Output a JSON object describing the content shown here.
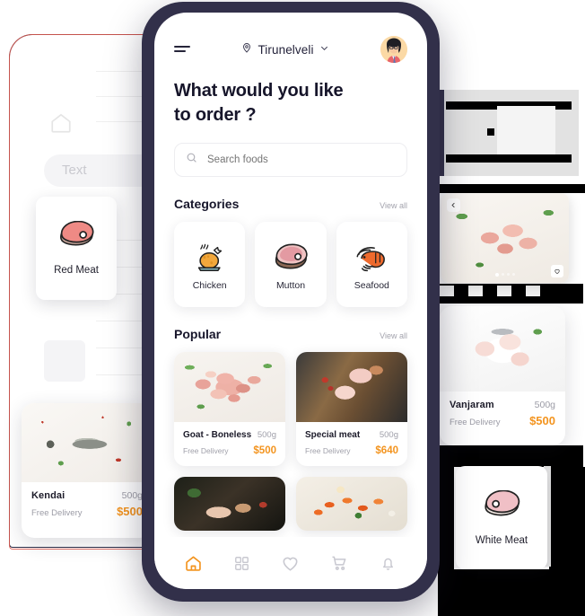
{
  "phone": {
    "header": {
      "menu_icon": "hamburger-menu-icon",
      "location_icon": "map-pin-icon",
      "location": "Tirunelveli",
      "chevron_icon": "chevron-down-icon",
      "avatar_icon": "user-avatar"
    },
    "heading_line1": "What would you like",
    "heading_line2": "to order ?",
    "search": {
      "icon": "search-icon",
      "placeholder": "Search foods",
      "value": ""
    },
    "categories_section": {
      "title": "Categories",
      "view_all": "View all",
      "items": [
        {
          "label": "Chicken",
          "icon": "roast-chicken-icon"
        },
        {
          "label": "Mutton",
          "icon": "steak-icon"
        },
        {
          "label": "Seafood",
          "icon": "shrimp-icon"
        }
      ]
    },
    "popular_section": {
      "title": "Popular",
      "view_all": "View all",
      "items": [
        {
          "name": "Goat - Boneless",
          "weight": "500g",
          "delivery": "Free Delivery",
          "price": "$500",
          "image": "raw-goat-meat-chunks"
        },
        {
          "name": "Special meat",
          "weight": "500g",
          "delivery": "Free Delivery",
          "price": "$640",
          "image": "sliced-ham-on-board"
        }
      ],
      "second_row": [
        {
          "image": "dark-plated-meat"
        },
        {
          "image": "cooked-prawns-platter"
        }
      ]
    },
    "bottom_nav": {
      "items": [
        {
          "name": "home",
          "icon": "home-icon",
          "active": true
        },
        {
          "name": "categories",
          "icon": "grid-icon",
          "active": false
        },
        {
          "name": "favorites",
          "icon": "heart-icon",
          "active": false
        },
        {
          "name": "cart",
          "icon": "cart-icon",
          "active": false
        },
        {
          "name": "notifications",
          "icon": "bell-icon",
          "active": false
        }
      ]
    }
  },
  "floating_cards": [
    {
      "id": "kendai",
      "name": "Kendai",
      "weight": "500g",
      "delivery": "Free Delivery",
      "price": "$500",
      "image": "whole-fish-on-board"
    },
    {
      "id": "vanjaram",
      "name": "Vanjaram",
      "weight": "500g",
      "delivery": "Free Delivery",
      "price": "$500",
      "image": "fish-steaks-on-plate"
    }
  ],
  "category_tiles": [
    {
      "id": "red-meat",
      "label": "Red Meat",
      "icon": "red-steak-icon"
    },
    {
      "id": "white-meat",
      "label": "White Meat",
      "icon": "white-steak-icon"
    }
  ],
  "detail_fragment": {
    "back_icon": "chevron-left-icon",
    "favorite_icon": "heart-outline-icon",
    "dots": 4,
    "active_dot": 1,
    "image": "raw-goat-meat-detail"
  },
  "ghost_phone": {
    "home_icon": "home-icon",
    "placeholder_text": "Text"
  },
  "colors": {
    "accent_orange": "#F3941F",
    "phone_frame": "#32304A",
    "text_dark": "#16152A",
    "text_muted": "#A0A0AA",
    "ghost_outline": "#E05A4F"
  }
}
